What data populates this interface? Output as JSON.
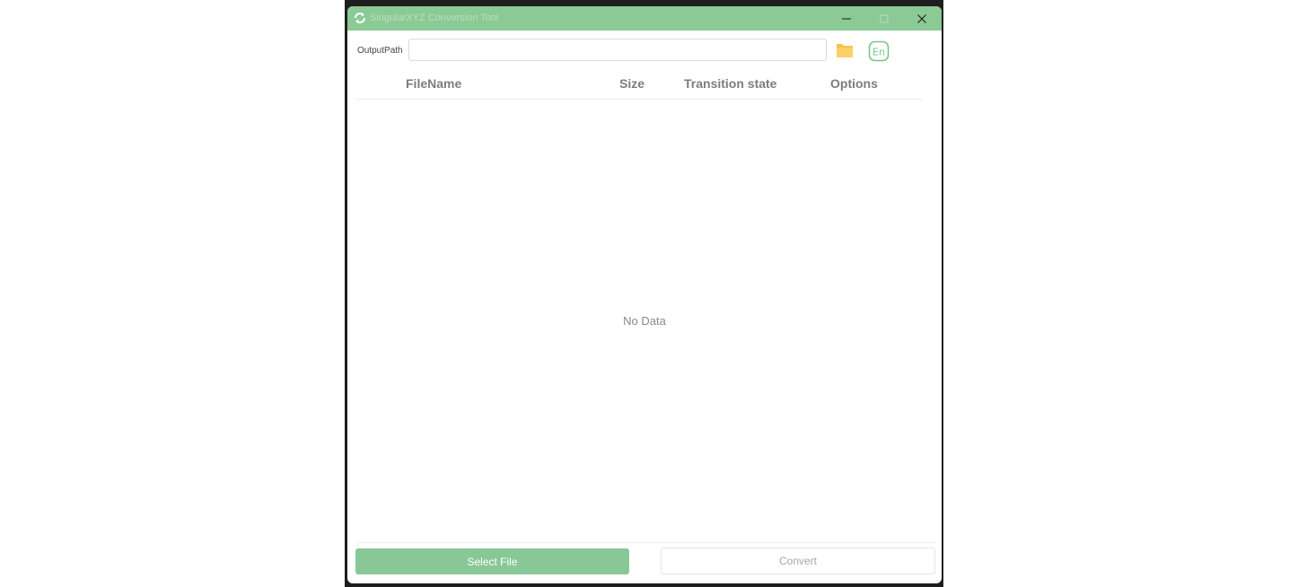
{
  "window": {
    "title": "SingularXYZ Conversion Tool",
    "icons": {
      "app": "sync-arrows-icon",
      "minimize": "minimize-icon",
      "maximize": "maximize-icon",
      "close": "close-icon"
    }
  },
  "output": {
    "label": "OutputPath",
    "value": "",
    "placeholder": "",
    "folder_icon": "folder-icon",
    "language_icon": "language-en-icon",
    "language_text": "En"
  },
  "table": {
    "columns": [
      "FileName",
      "Size",
      "Transition state",
      "Options"
    ],
    "rows": [],
    "empty_text": "No Data"
  },
  "footer": {
    "select_label": "Select File",
    "convert_label": "Convert"
  },
  "colors": {
    "accent": "#8bc995",
    "folder": "#f6c24a",
    "header_text": "#7d7d7d"
  }
}
